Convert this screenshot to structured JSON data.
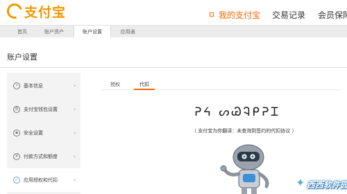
{
  "header": {
    "logo_text": "支付宝",
    "nav": {
      "mine": "我的支付宝",
      "trade": "交易记录",
      "vip": "会员保障"
    }
  },
  "subnav": {
    "items": [
      "首页",
      "账户资产",
      "账户设置",
      "应用通"
    ],
    "active": "账户设置"
  },
  "page_title": "账户设置",
  "sidebar": {
    "items": [
      {
        "label": "基本信息",
        "icon": "user-icon"
      },
      {
        "label": "支付宝钱包设置",
        "icon": "wallet-icon"
      },
      {
        "label": "安全设置",
        "icon": "lock-icon"
      },
      {
        "label": "付款方式和额度",
        "icon": "yen-icon"
      },
      {
        "label": "应用授权和代扣",
        "icon": "check-icon"
      }
    ],
    "active": "应用授权和代扣"
  },
  "tabs": {
    "items": [
      "授权",
      "代扣"
    ],
    "active": "代扣"
  },
  "content": {
    "glyph_title": "ᕈᔦ ᔕᏊᎸᑭᕈᏆ",
    "note": "（ 支付宝为你翻译：未查询到签约的代扣协议 ）"
  },
  "watermark": "西西软件园",
  "colors": {
    "accent": "#ff6600",
    "brand": "#f39800",
    "sidebar_bg": "#f3f3f3",
    "subnav_bg": "#ececec",
    "active_icon": "#6aa2d8"
  }
}
